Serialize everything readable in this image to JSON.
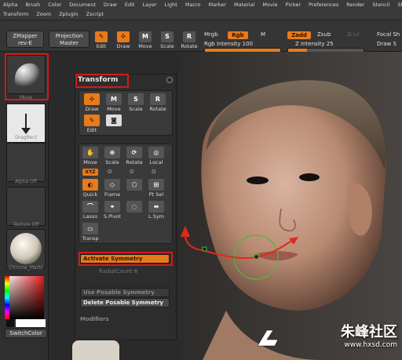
{
  "menu": {
    "row1": [
      "Alpha",
      "Brush",
      "Color",
      "Document",
      "Draw",
      "Edit",
      "Layer",
      "Light",
      "Macro",
      "Marker",
      "Material",
      "Movie",
      "Picker",
      "Preferences",
      "Render",
      "Stencil",
      "Stroke"
    ],
    "row2": [
      "Transform",
      "Zoom",
      "Zplugin",
      "Zscript"
    ]
  },
  "toolbar": {
    "zmapper_label": "ZMapper",
    "zmapper_sub": "rev-E",
    "projection_label": "Projection",
    "projection_sub": "Master",
    "tools": {
      "edit": "Edit",
      "draw": "Draw",
      "move": "Move",
      "scale": "Scale",
      "rotate": "Rotate"
    },
    "mrgb": "Mrgb",
    "rgb": "Rgb",
    "m": "M",
    "rgb_intensity": "Rgb Intensity 100",
    "zadd": "Zadd",
    "zsub": "Zsub",
    "zcut": "Zcut",
    "z_intensity": "Z Intensity 25",
    "focal_shift": "Focal Sh",
    "draw_size": "Draw S",
    "rgb_intensity_value": 1.0,
    "z_intensity_value": 0.25
  },
  "shelf": {
    "move_label": "Move",
    "dragrect_label": "DragRect",
    "alpha_label": "Alpha Off",
    "texture_label": "Texture Off",
    "material_label": "Chrome_Marbl",
    "switch_color": "SwitchColor"
  },
  "panel": {
    "title": "Transform",
    "draw": "Draw",
    "move": "Move",
    "scale": "Scale",
    "rotate": "Rotate",
    "edit": "Edit",
    "move2": "Move",
    "scale2": "Scale",
    "rotate2": "Rotate",
    "local": "Local",
    "xyz": "XYZ",
    "quick": "Quick",
    "frame": "Frame",
    "ptsel": "Pt Sel",
    "lasso": "Lasso",
    "spivot": "S.Pivot",
    "lsym": "L.Sym",
    "transp": "Transp",
    "activate_symmetry": "Activate Symmetry",
    "radial_count": "RadialCount 8",
    "use_posable": "Use Posable Symmetry",
    "delete_posable": "Delete Posable Symmetry",
    "modifiers": "Modifiers"
  },
  "watermark": {
    "line1": "朱峰社区",
    "line2": "www.hxsd.com"
  }
}
